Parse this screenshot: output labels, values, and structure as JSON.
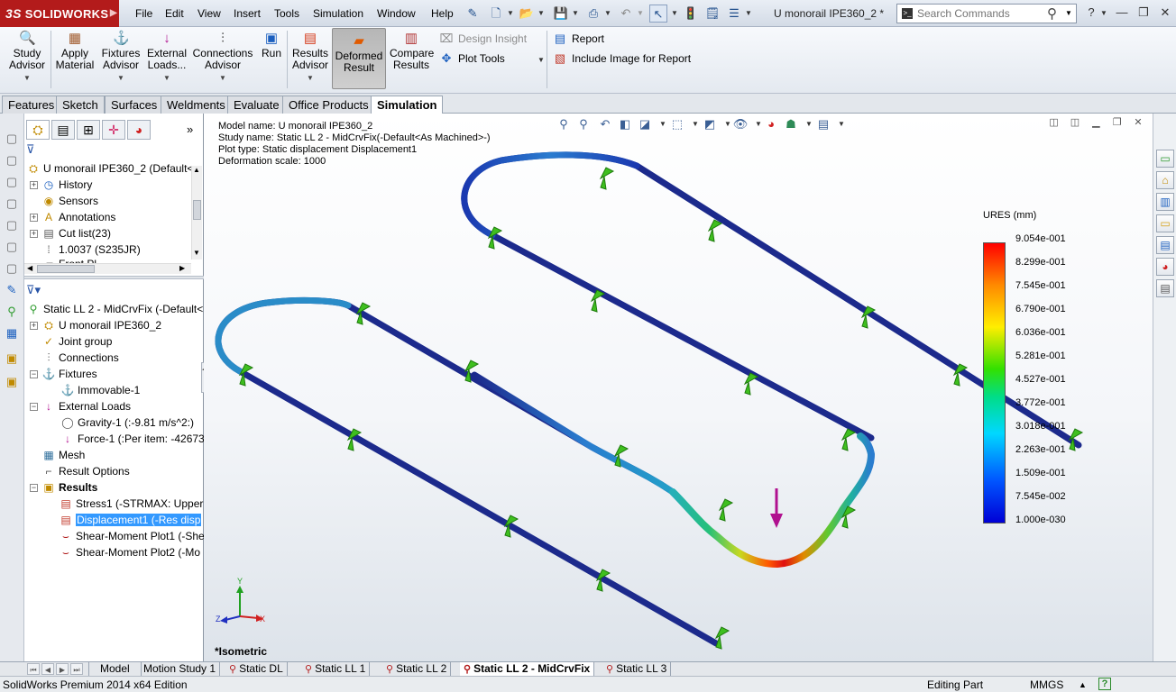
{
  "app": {
    "brand": "SOLIDWORKS",
    "brand_prefix": "3S",
    "document_title": "U monorail IPE360_2 *",
    "menus": [
      "File",
      "Edit",
      "View",
      "Insert",
      "Tools",
      "Simulation",
      "Window",
      "Help"
    ]
  },
  "search": {
    "placeholder": "Search Commands"
  },
  "commands": {
    "study_advisor": "Study Advisor",
    "apply_material": "Apply Material",
    "fixtures_advisor": "Fixtures Advisor",
    "external_loads": "External Loads...",
    "connections_advisor": "Connections Advisor",
    "run": "Run",
    "results_advisor": "Results Advisor",
    "deformed_result": "Deformed Result",
    "compare_results": "Compare Results",
    "design_insight": "Design Insight",
    "plot_tools": "Plot Tools",
    "report": "Report",
    "include_image": "Include Image for Report"
  },
  "tabs": [
    "Features",
    "Sketch",
    "Surfaces",
    "Weldments",
    "Evaluate",
    "Office Products",
    "Simulation"
  ],
  "active_tab": "Simulation",
  "feature_tree": {
    "root": "U monorail IPE360_2  (Default<",
    "items": [
      {
        "label": "History",
        "icon": "history-icon"
      },
      {
        "label": "Sensors",
        "icon": "sensor-icon"
      },
      {
        "label": "Annotations",
        "icon": "annotations-icon"
      },
      {
        "label": "Cut list(23)",
        "icon": "cutlist-icon"
      },
      {
        "label": "1.0037 (S235JR)",
        "icon": "material-icon"
      },
      {
        "label": "Front Pl...",
        "icon": "plane-icon"
      }
    ]
  },
  "sim_tree": {
    "study": "Static LL 2 - MidCrvFix (-Default<",
    "part": "U monorail IPE360_2",
    "joint_group": "Joint group",
    "connections": "Connections",
    "fixtures": "Fixtures",
    "immovable": "Immovable-1",
    "external_loads": "External Loads",
    "gravity": "Gravity-1 (:-9.81 m/s^2:)",
    "force": "Force-1 (:Per item: -42673.",
    "mesh": "Mesh",
    "result_options": "Result Options",
    "results": "Results",
    "stress": "Stress1 (-STRMAX: Upper I",
    "displacement": "Displacement1 (-Res disp",
    "shear1": "Shear-Moment Plot1 (-She",
    "shear2": "Shear-Moment Plot2 (-Mo"
  },
  "graphics": {
    "model_name": "Model name: U monorail IPE360_2",
    "study_name": "Study name: Static LL 2 - MidCrvFix(-Default<As Machined>-)",
    "plot_type": "Plot type: Static displacement Displacement1",
    "deformation_scale": "Deformation scale: 1000",
    "view_label": "*Isometric",
    "triad": {
      "x": "X",
      "y": "Y",
      "z": "Z"
    }
  },
  "legend": {
    "title": "URES (mm)",
    "values": [
      "9.054e-001",
      "8.299e-001",
      "7.545e-001",
      "6.790e-001",
      "6.036e-001",
      "5.281e-001",
      "4.527e-001",
      "3.772e-001",
      "3.018e-001",
      "2.263e-001",
      "1.509e-001",
      "7.545e-002",
      "1.000e-030"
    ]
  },
  "bottom_tabs": [
    "Model",
    "Motion Study 1",
    "Static DL",
    "Static LL 1",
    "Static LL 2",
    "Static LL 2 - MidCrvFix",
    "Static LL 3"
  ],
  "active_bottom_tab": "Static LL 2 - MidCrvFix",
  "status": {
    "edition": "SolidWorks Premium 2014 x64 Edition",
    "mode": "Editing Part",
    "units": "MMGS"
  },
  "colors": {
    "brand_red": "#b31b1b",
    "beam_blue": "#1c2a8c",
    "support_green": "#3fbf1f",
    "force_magenta": "#b0108f"
  }
}
